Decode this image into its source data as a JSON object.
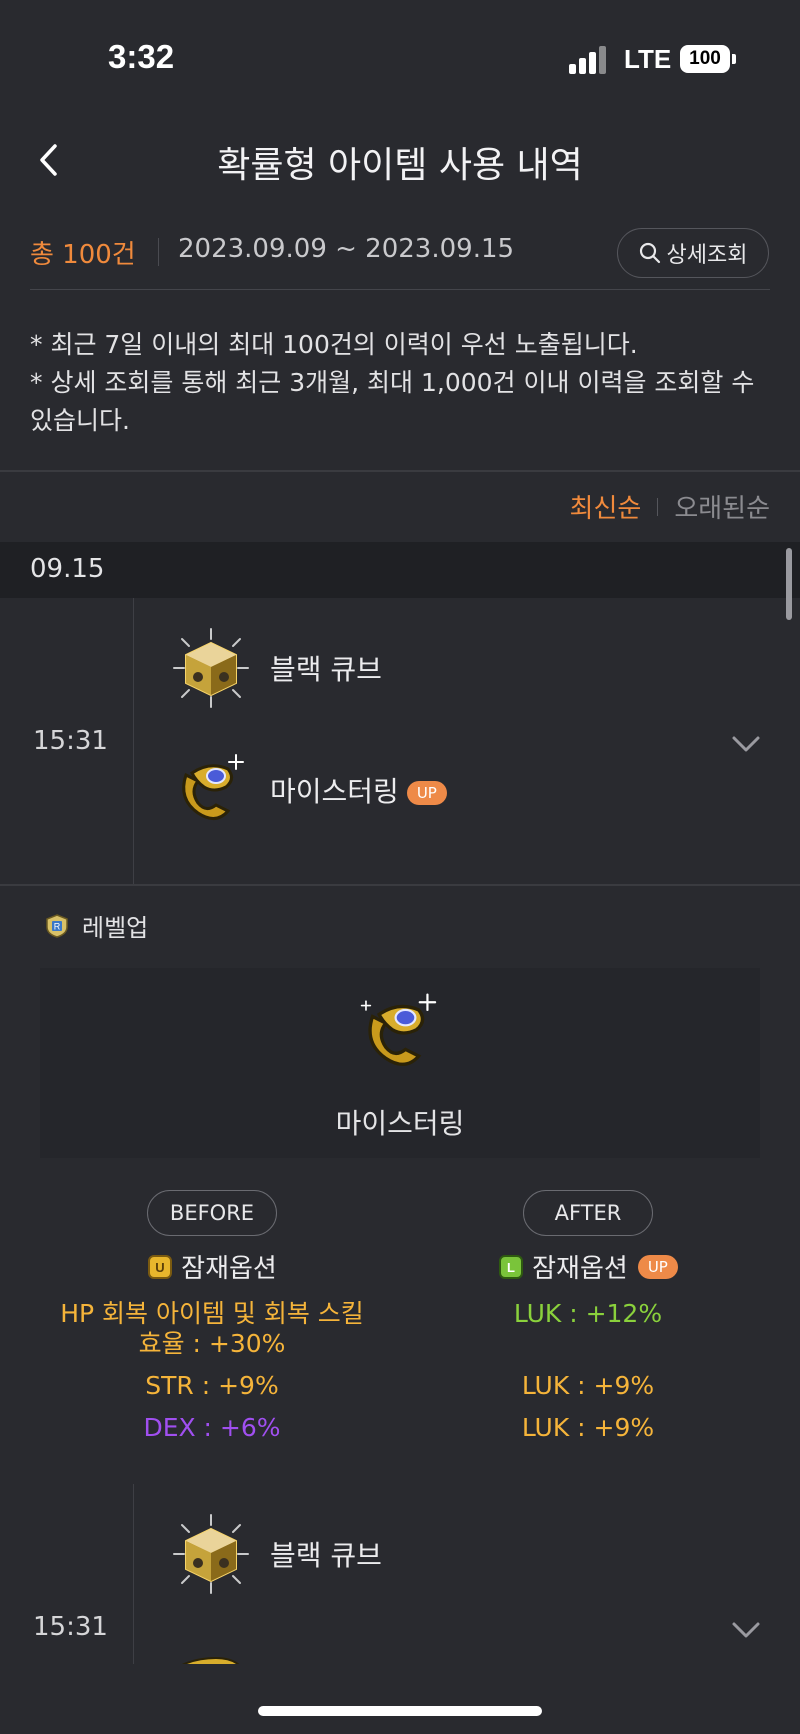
{
  "status": {
    "time": "3:32",
    "network": "LTE",
    "battery": "100"
  },
  "header": {
    "title": "확률형 아이템 사용 내역",
    "back_icon": "chevron-left-icon"
  },
  "summary": {
    "total": "총 100건",
    "date_range": "2023.09.09 ~ 2023.09.15",
    "detail_button": "상세조회"
  },
  "notice": {
    "line1": "* 최근 7일 이내의 최대 100건의 이력이 우선 노출됩니다.",
    "line2": "* 상세 조회를 통해 최근 3개월, 최대 1,000건 이내 이력을 조회할 수 있습니다."
  },
  "sort": {
    "newest": "최신순",
    "oldest": "오래된순"
  },
  "date_group": "09.15",
  "entries": [
    {
      "time": "15:31",
      "item1": "블랙 큐브",
      "item2": "마이스터링",
      "badge": "UP"
    },
    {
      "time": "15:31",
      "item1": "블랙 큐브"
    }
  ],
  "detail": {
    "grade_label": "레벨업",
    "item_name": "마이스터링",
    "before": {
      "label": "BEFORE",
      "option_title": "잠재옵션",
      "line1": "HP 회복 아이템 및 회복 스킬",
      "line1b": "효율 : +30%",
      "line2": "STR : +9%",
      "line3": "DEX : +6%"
    },
    "after": {
      "label": "AFTER",
      "option_title": "잠재옵션",
      "badge": "UP",
      "line1": "LUK : +12%",
      "line2": "LUK : +9%",
      "line3": "LUK : +9%"
    }
  },
  "colors": {
    "accent": "#f08a3c",
    "unique": "#f5b43a",
    "legendary": "#8ad13c",
    "epic": "#a04ff0",
    "background": "#292a2f"
  }
}
